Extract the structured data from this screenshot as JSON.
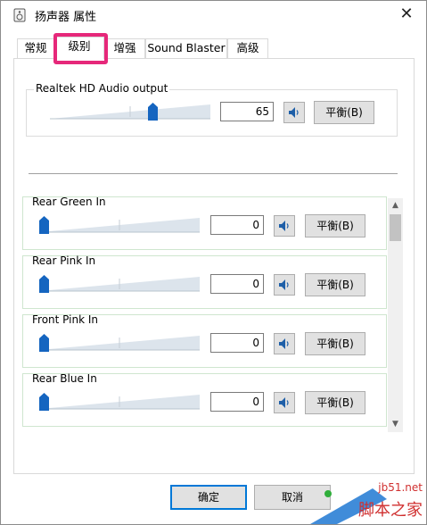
{
  "window": {
    "title": "扬声器 属性",
    "close": "✕"
  },
  "tabs": [
    {
      "label": "常规"
    },
    {
      "label": "级别"
    },
    {
      "label": "增强"
    },
    {
      "label": "Sound Blaster"
    },
    {
      "label": "高级"
    }
  ],
  "main_output": {
    "label": "Realtek HD Audio output",
    "value": "65",
    "level": 0.65,
    "balance": "平衡(B)"
  },
  "inputs": [
    {
      "label": "Rear Green In",
      "value": "0",
      "level": 0,
      "balance": "平衡(B)"
    },
    {
      "label": "Rear Pink In",
      "value": "0",
      "level": 0,
      "balance": "平衡(B)"
    },
    {
      "label": "Front Pink In",
      "value": "0",
      "level": 0,
      "balance": "平衡(B)"
    },
    {
      "label": "Rear Blue In",
      "value": "0",
      "level": 0,
      "balance": "平衡(B)"
    }
  ],
  "footer": {
    "ok": "确定",
    "cancel": "取消"
  },
  "watermark": {
    "site": "jb51.net",
    "name": "脚本之家"
  },
  "colors": {
    "accent": "#0078d7",
    "highlight": "#e6287a",
    "thumb": "#1565c0"
  }
}
